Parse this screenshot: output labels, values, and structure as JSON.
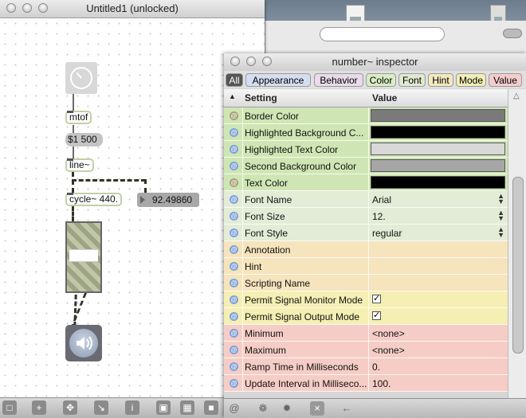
{
  "patcher": {
    "title": "Untitled1 (unlocked)",
    "objects": {
      "mtof": "mtof",
      "message": "$1 500",
      "line": "line~",
      "cycle": "cycle~ 440.",
      "number_value": "92.49860"
    },
    "toolbar_icons": [
      "lock-icon",
      "new-object-icon",
      "move-icon",
      "chart-icon",
      "info-icon",
      "presentation-icon",
      "grid-icon",
      "palette-icon"
    ]
  },
  "inspector": {
    "title": "number~ inspector",
    "tabs": [
      {
        "label": "All",
        "color": "#555555"
      },
      {
        "label": "Appearance",
        "color": "#d4def0"
      },
      {
        "label": "Behavior",
        "color": "#e9dbe9"
      },
      {
        "label": "Color",
        "color": "#d9ecc4"
      },
      {
        "label": "Font",
        "color": "#dfe9cf"
      },
      {
        "label": "Hint",
        "color": "#f3e8c0"
      },
      {
        "label": "Mode",
        "color": "#f1edb6"
      },
      {
        "label": "Value",
        "color": "#f4cccc"
      }
    ],
    "header": {
      "setting": "Setting",
      "value": "Value"
    },
    "rows": [
      {
        "name": "Border Color",
        "kind": "swatch",
        "swatch": "#7a7a7a",
        "bg": "#cfe6b4"
      },
      {
        "name": "Highlighted Background C...",
        "kind": "swatch",
        "swatch": "#000000",
        "bg": "#cfe6b4"
      },
      {
        "name": "Highlighted Text Color",
        "kind": "swatch",
        "swatch": "#d8d8d8",
        "bg": "#cfe6b4"
      },
      {
        "name": "Second Background Color",
        "kind": "swatch",
        "swatch": "#a6a6a6",
        "bg": "#cfe6b4"
      },
      {
        "name": "Text Color",
        "kind": "swatch",
        "swatch": "#000000",
        "bg": "#cfe6b4"
      },
      {
        "name": "Font Name",
        "kind": "select",
        "value": "Arial",
        "bg": "#e3ecd6"
      },
      {
        "name": "Font Size",
        "kind": "select",
        "value": "12.",
        "bg": "#e3ecd6"
      },
      {
        "name": "Font Style",
        "kind": "select",
        "value": "regular",
        "bg": "#e3ecd6"
      },
      {
        "name": "Annotation",
        "kind": "text",
        "value": "",
        "bg": "#f6e4bd"
      },
      {
        "name": "Hint",
        "kind": "text",
        "value": "",
        "bg": "#f6e4bd"
      },
      {
        "name": "Scripting Name",
        "kind": "text",
        "value": "",
        "bg": "#f6e4bd"
      },
      {
        "name": "Permit Signal Monitor Mode",
        "kind": "check",
        "value": "✓",
        "bg": "#f5efb4"
      },
      {
        "name": "Permit Signal Output Mode",
        "kind": "check",
        "value": "✓",
        "bg": "#f5efb4"
      },
      {
        "name": "Minimum",
        "kind": "text",
        "value": "<none>",
        "bg": "#f5cdc6"
      },
      {
        "name": "Maximum",
        "kind": "text",
        "value": "<none>",
        "bg": "#f5cdc6"
      },
      {
        "name": "Ramp Time in Milliseconds",
        "kind": "text",
        "value": "0.",
        "bg": "#f5cdc6"
      },
      {
        "name": "Update Interval in Milliseco...",
        "kind": "text",
        "value": "100.",
        "bg": "#f5cdc6"
      }
    ],
    "at_symbol": "@",
    "bottom_icons": [
      "at-icon",
      "gear-icon",
      "settings-icon",
      "close-icon",
      "back-arrow-icon"
    ]
  }
}
